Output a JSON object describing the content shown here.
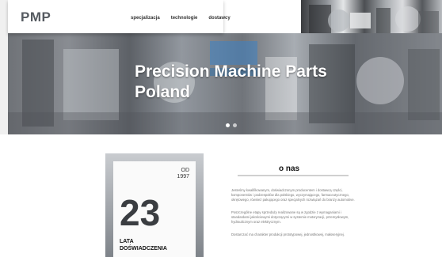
{
  "header": {
    "logo": "PMP",
    "nav": [
      "specjalizacja",
      "technologie",
      "dostawcy"
    ]
  },
  "hero": {
    "title_line1": "Precision Machine Parts",
    "title_line2": "Poland",
    "dots": 2
  },
  "experience": {
    "od_label": "OD",
    "year": "1997",
    "years": "23",
    "label_line1": "LATA",
    "label_line2": "DOŚWIADCZENIA"
  },
  "about": {
    "title": "o nas",
    "para1": "Jesteśmy kwalifikowanym, doświadczonym producentem i dostawcą części, komponentów i podzespołów dla polskiego, wyczymającego, farmaceutycznego, okrętowego, również pakującego oraz specjalnych rozwiązań do branży automotive.",
    "para2": "Poszczególne etapy sprzedaży realizowane są w zgodzie z wymaganiami i standardami jakościowymi dotyczącymi w systemie motoryzacji, przemysłowym, hydraulicznym oraz elektrycznym.",
    "para3": "Dostarczać ma charakter produkcji prototypowej, jednostkowej, małoseryjnej."
  }
}
